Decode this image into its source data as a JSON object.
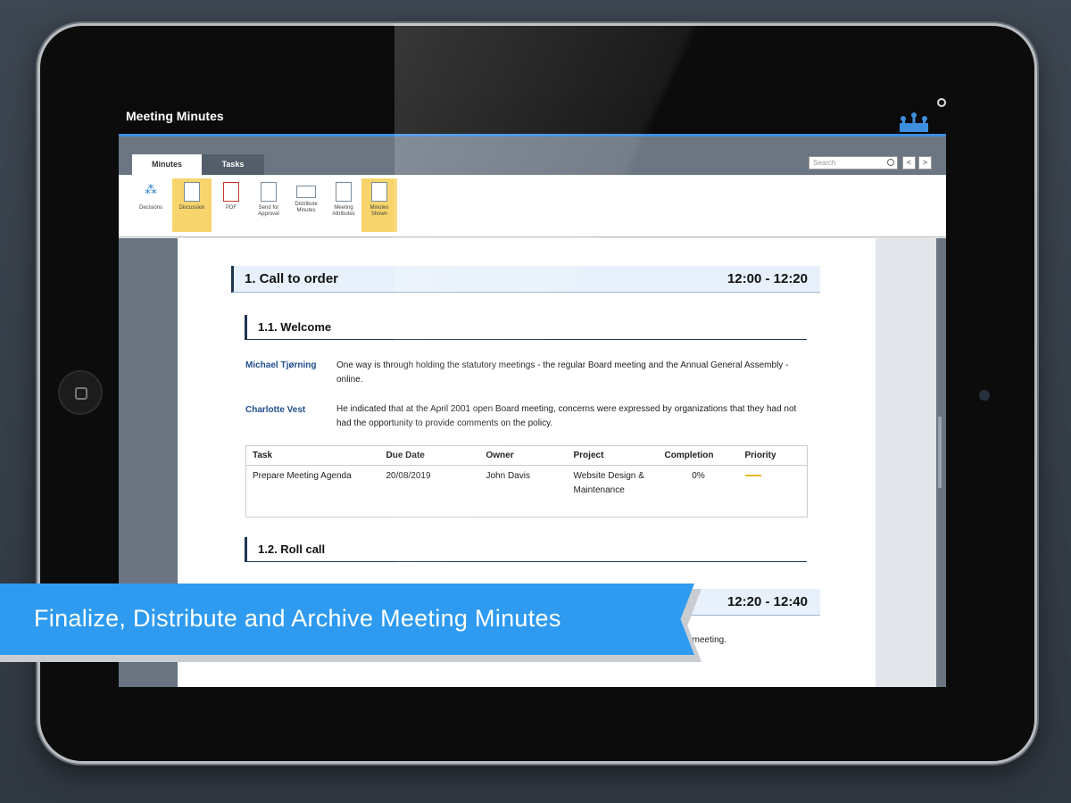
{
  "app": {
    "title": "Meeting Minutes"
  },
  "tabs": [
    {
      "label": "Minutes"
    },
    {
      "label": "Tasks"
    }
  ],
  "search": {
    "placeholder": "Search"
  },
  "nav": {
    "prev": "<",
    "next": ">"
  },
  "ribbon": [
    {
      "label": "Decisions"
    },
    {
      "label": "Discussion"
    },
    {
      "label": "PDF"
    },
    {
      "label": "Send for Approval"
    },
    {
      "label": "Distribute Minutes"
    },
    {
      "label": "Meeting Attributes"
    },
    {
      "label": "Minutes Shown"
    }
  ],
  "agenda": {
    "item1": {
      "title": "1. Call to order",
      "time": "12:00 - 12:20"
    },
    "sub1": {
      "title": "1.1. Welcome"
    },
    "speakers": [
      {
        "name": "Michael Tjørning",
        "text": "One way is through holding the statutory meetings - the regular Board meeting and the Annual General Assembly - online."
      },
      {
        "name": "Charlotte Vest",
        "text": "He indicated that at the April 2001 open Board meeting, concerns were expressed by organizations that they had not had the opportunity to provide comments on the policy."
      }
    ],
    "task_table": {
      "headers": [
        "Task",
        "Due Date",
        "Owner",
        "Project",
        "Completion",
        "Priority"
      ],
      "rows": [
        {
          "task": "Prepare Meeting Agenda",
          "due": "20/08/2019",
          "owner": "John Davis",
          "project": "Website Design & Maintenance",
          "completion": "0%"
        }
      ]
    },
    "sub2": {
      "title": "1.2. Roll call"
    },
    "item2": {
      "time": "12:20 - 12:40"
    },
    "fragment": "rd meeting."
  },
  "banner": {
    "text": "Finalize, Distribute and Archive Meeting Minutes"
  },
  "colors": {
    "accent": "#2e9bf0",
    "highlight": "#f7d56c",
    "heading_bar": "#1e3552"
  }
}
